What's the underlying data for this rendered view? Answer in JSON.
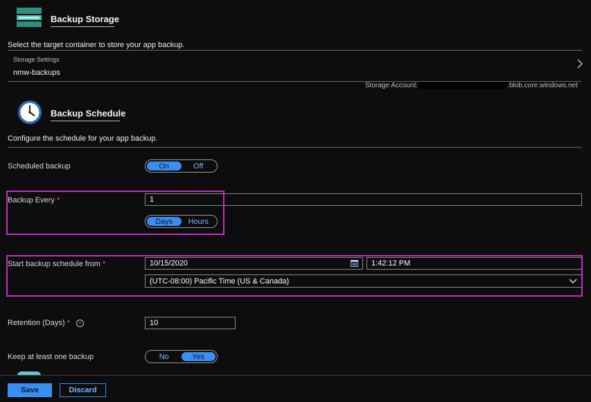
{
  "storage": {
    "title": "Backup Storage",
    "description": "Select the target container to store your app backup.",
    "settings_label": "Storage Settings",
    "container_value": "nmw-backups",
    "account_label": "Storage Account:",
    "account_suffix": ".blob.core.windows.net"
  },
  "schedule": {
    "title": "Backup Schedule",
    "description": "Configure the schedule for your app backup.",
    "scheduled_backup": {
      "label": "Scheduled backup",
      "options": [
        "On",
        "Off"
      ],
      "selected": "On"
    },
    "backup_every": {
      "label": "Backup Every",
      "required_mark": "*",
      "value": "1",
      "unit_options": [
        "Days",
        "Hours"
      ],
      "selected_unit": "Days"
    },
    "start_from": {
      "label": "Start backup schedule from",
      "required_mark": "*",
      "date": "10/15/2020",
      "time": "1:42:12 PM",
      "timezone": "(UTC-08:00) Pacific Time (US & Canada)"
    },
    "retention": {
      "label": "Retention (Days)",
      "required_mark": "*",
      "info_glyph": "i",
      "value": "10"
    },
    "keep_one": {
      "label": "Keep at least one backup",
      "options": [
        "No",
        "Yes"
      ],
      "selected": "Yes"
    }
  },
  "footer": {
    "save_label": "Save",
    "discard_label": "Discard"
  },
  "colors": {
    "accent": "#3a8ef2",
    "highlight": "#c230c2",
    "required": "#e06b6b"
  }
}
